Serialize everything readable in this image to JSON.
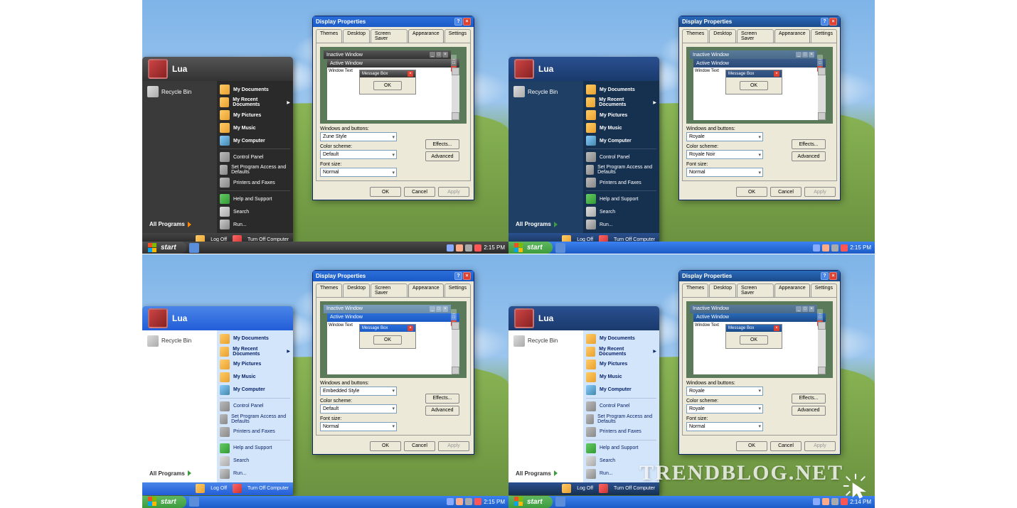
{
  "watermark": "TRENDBLOG.NET",
  "display_props": {
    "title": "Display Properties",
    "tabs": [
      "Themes",
      "Desktop",
      "Screen Saver",
      "Appearance",
      "Settings"
    ],
    "preview": {
      "inactive": "Inactive Window",
      "active": "Active Window",
      "msgbox": "Message Box",
      "wintext": "Window Text",
      "ok": "OK"
    },
    "labels": {
      "wab": "Windows and buttons:",
      "scheme": "Color scheme:",
      "font": "Font size:"
    },
    "font_val": "Normal",
    "buttons": {
      "effects": "Effects...",
      "advanced": "Advanced",
      "ok": "OK",
      "cancel": "Cancel",
      "apply": "Apply"
    }
  },
  "quads": [
    {
      "wab": "Zune Style",
      "scheme": "Default",
      "theme": "dark",
      "smtitle": "pi-dark",
      "atitle": "pa-dark",
      "tbar": "tb-dark",
      "start": "sb-dark",
      "sm": "sm-dark",
      "smh": "sm-h-dark",
      "sml": "sm-l-dark",
      "smr": "sm-r-dark",
      "smf": "sm-f-dark",
      "allarrow": "or",
      "time": "2:15 PM"
    },
    {
      "wab": "Royale",
      "scheme": "Royale Noir",
      "theme": "noir",
      "smtitle": "pi-royale",
      "atitle": "pa-noir",
      "tbar": "tb-xp",
      "start": "sb-green",
      "sm": "sm-darkblue",
      "smh": "sm-h-royale",
      "sml": "sm-l-darkblue",
      "smr": "sm-r-darkblue",
      "smf": "sm-f-darkblue",
      "allarrow": "",
      "time": "2:15 PM"
    },
    {
      "wab": "Embedded Style",
      "scheme": "Default",
      "theme": "xp",
      "smtitle": "pi-xp",
      "atitle": "pa-xp",
      "tbar": "tb-xp",
      "start": "sb-green",
      "sm": "sm-blue",
      "smh": "sm-h-blue",
      "sml": "sm-l-white",
      "smr": "sm-r-blue",
      "smf": "sm-f-blue",
      "allarrow": "",
      "time": "2:15 PM"
    },
    {
      "wab": "Royale",
      "scheme": "Royale",
      "theme": "royale",
      "smtitle": "pi-royale",
      "atitle": "pa-royale",
      "tbar": "tb-xp",
      "start": "sb-green",
      "sm": "sm-blue",
      "smh": "sm-h-royale",
      "sml": "sm-l-white",
      "smr": "sm-r-blue",
      "smf": "sm-f-darkblue",
      "allarrow": "",
      "time": "2:14 PM"
    }
  ],
  "startmenu": {
    "user": "Lua",
    "recycle": "Recycle Bin",
    "allprog": "All Programs",
    "right": [
      {
        "ico": "fold-ico",
        "t": "My Documents",
        "b": true
      },
      {
        "ico": "fold-ico",
        "t": "My Recent Documents",
        "b": true,
        "arr": true
      },
      {
        "ico": "fold-ico",
        "t": "My Pictures",
        "b": true
      },
      {
        "ico": "fold-ico",
        "t": "My Music",
        "b": true
      },
      {
        "ico": "comp-ico",
        "t": "My Computer",
        "b": true
      },
      {
        "sep": true
      },
      {
        "ico": "ctrl-ico",
        "t": "Control Panel"
      },
      {
        "ico": "ctrl-ico",
        "t": "Set Program Access and Defaults"
      },
      {
        "ico": "ctrl-ico",
        "t": "Printers and Faxes"
      },
      {
        "sep": true
      },
      {
        "ico": "help-ico",
        "t": "Help and Support"
      },
      {
        "ico": "srch-ico",
        "t": "Search"
      },
      {
        "ico": "run-ico",
        "t": "Run..."
      }
    ],
    "foot": {
      "logoff": "Log Off",
      "turnoff": "Turn Off Computer"
    }
  },
  "taskbar": {
    "start": "start"
  }
}
